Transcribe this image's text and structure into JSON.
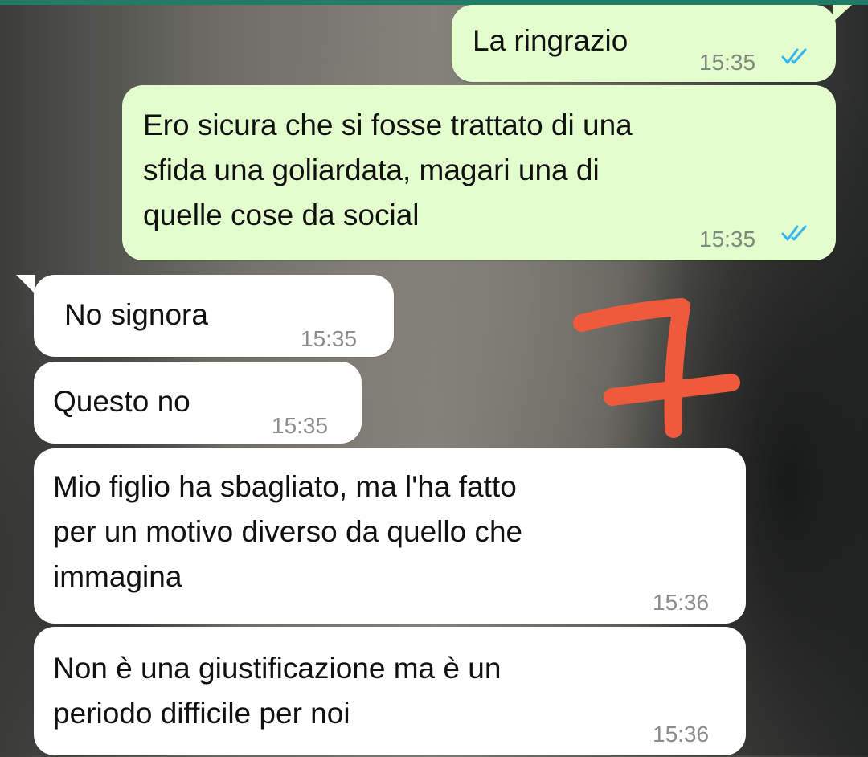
{
  "messages": [
    {
      "direction": "outgoing",
      "text": "La ringrazio",
      "time": "15:35",
      "status": "read-double-check-icon"
    },
    {
      "direction": "outgoing",
      "text": "Ero sicura che si fosse trattato di una\nsfida una goliardata, magari una di\nquelle cose da social",
      "time": "15:35",
      "status": "read-double-check-icon"
    },
    {
      "direction": "incoming",
      "text": "No signora",
      "time": "15:35"
    },
    {
      "direction": "incoming",
      "text": "Questo no",
      "time": "15:35"
    },
    {
      "direction": "incoming",
      "text": "Mio figlio ha sbagliato, ma l'ha fatto\nper un motivo diverso da quello che\nimmagina",
      "time": "15:36"
    },
    {
      "direction": "incoming",
      "text": "Non è una giustificazione ma è un\nperiodo difficile per noi",
      "time": "15:36"
    }
  ],
  "annotation": {
    "text": "7",
    "color": "#f05a3c"
  },
  "colors": {
    "outgoing_bubble": "#e3fdcd",
    "incoming_bubble": "#ffffff",
    "read_ticks": "#34b7f1",
    "header_strip": "#1f7d67"
  }
}
